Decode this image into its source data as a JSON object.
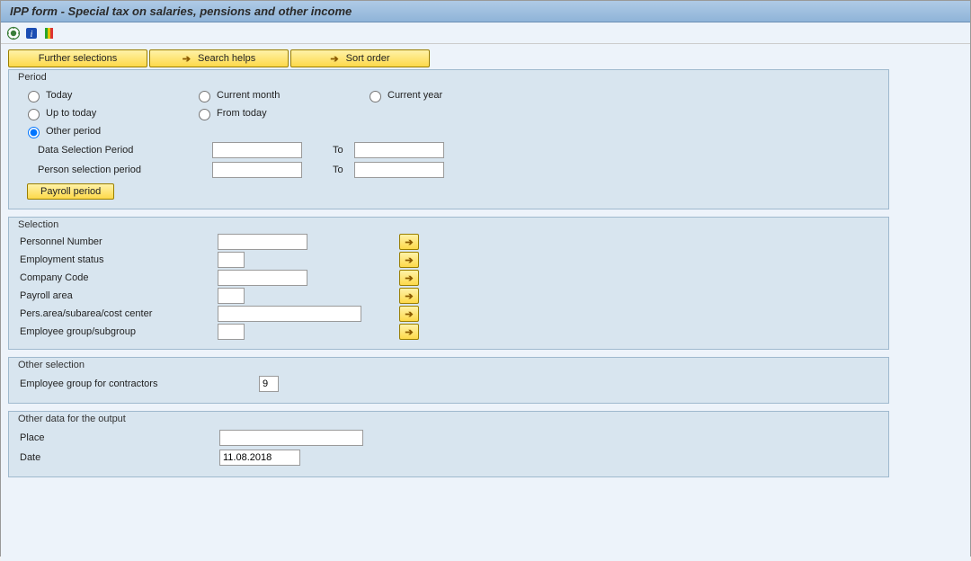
{
  "window": {
    "title": "IPP form - Special tax on salaries, pensions and other income"
  },
  "buttons": {
    "further_selections": "Further selections",
    "search_helps": "Search helps",
    "sort_order": "Sort order"
  },
  "period": {
    "title": "Period",
    "radios": {
      "today": "Today",
      "current_month": "Current month",
      "current_year": "Current year",
      "up_to_today": "Up to today",
      "from_today": "From today",
      "other_period": "Other period"
    },
    "selected": "other_period",
    "data_sel_label": "Data Selection Period",
    "person_sel_label": "Person selection period",
    "to_label": "To",
    "data_sel_from": "",
    "data_sel_to": "",
    "person_sel_from": "",
    "person_sel_to": "",
    "payroll_btn": "Payroll period"
  },
  "selection": {
    "title": "Selection",
    "rows": [
      {
        "label": "Personnel Number",
        "value": "",
        "input_w": "w100"
      },
      {
        "label": "Employment status",
        "value": "",
        "input_w": "w30"
      },
      {
        "label": "Company Code",
        "value": "",
        "input_w": "w100"
      },
      {
        "label": "Payroll area",
        "value": "",
        "input_w": "w30"
      },
      {
        "label": "Pers.area/subarea/cost center",
        "value": "",
        "input_w": "w160"
      },
      {
        "label": "Employee group/subgroup",
        "value": "",
        "input_w": "w30"
      }
    ]
  },
  "other_selection": {
    "title": "Other selection",
    "label": "Employee group for contractors",
    "value": "9"
  },
  "output": {
    "title": "Other data for the output",
    "place_label": "Place",
    "place_value": "",
    "date_label": "Date",
    "date_value": "11.08.2018"
  }
}
